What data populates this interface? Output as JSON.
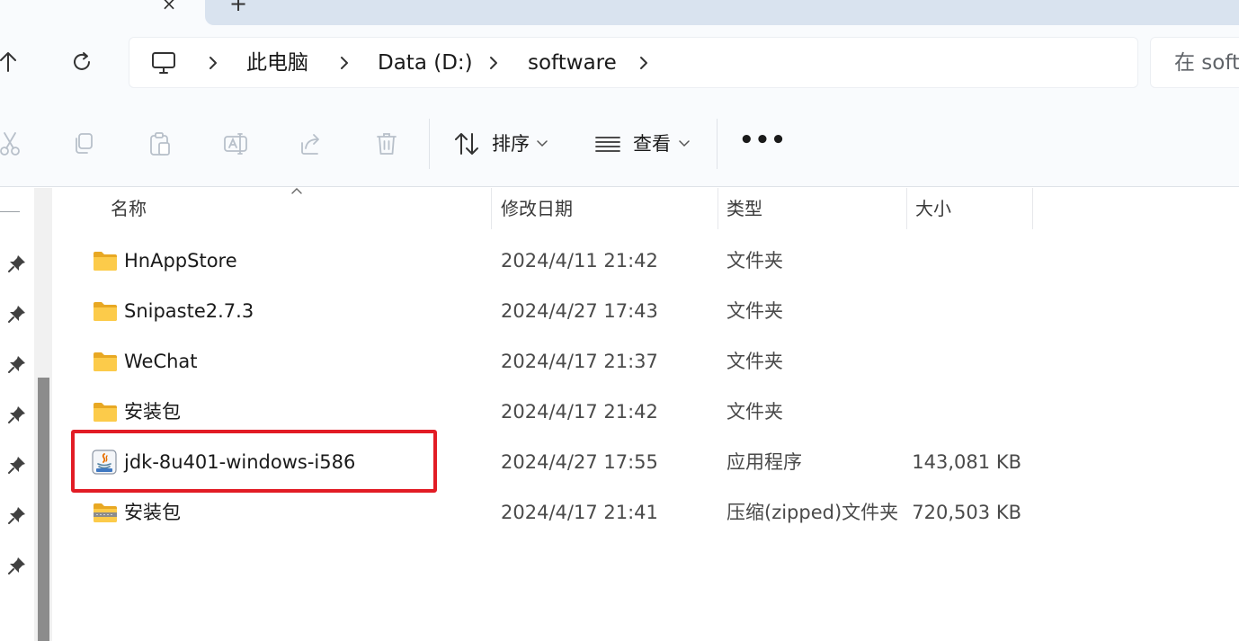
{
  "breadcrumb": {
    "items": [
      "此电脑",
      "Data (D:)",
      "software"
    ]
  },
  "search": {
    "placeholder": "在 soft"
  },
  "commands": {
    "sort_label": "排序",
    "view_label": "查看",
    "more_label": "•••"
  },
  "columns": {
    "name": "名称",
    "date": "修改日期",
    "type": "类型",
    "size": "大小"
  },
  "files": [
    {
      "name": "HnAppStore",
      "date": "2024/4/11 21:42",
      "type": "文件夹",
      "size": "",
      "icon": "folder-icon"
    },
    {
      "name": "Snipaste2.7.3",
      "date": "2024/4/27 17:43",
      "type": "文件夹",
      "size": "",
      "icon": "folder-icon"
    },
    {
      "name": "WeChat",
      "date": "2024/4/17 21:37",
      "type": "文件夹",
      "size": "",
      "icon": "folder-icon"
    },
    {
      "name": "安装包",
      "date": "2024/4/17 21:42",
      "type": "文件夹",
      "size": "",
      "icon": "folder-icon"
    },
    {
      "name": "jdk-8u401-windows-i586",
      "date": "2024/4/27 17:55",
      "type": "应用程序",
      "size": "143,081 KB",
      "icon": "java-installer-icon"
    },
    {
      "name": "安装包",
      "date": "2024/4/17 21:41",
      "type": "压缩(zipped)文件夹",
      "size": "720,503 KB",
      "icon": "zip-folder-icon"
    }
  ],
  "highlight_color": "#e21c25"
}
